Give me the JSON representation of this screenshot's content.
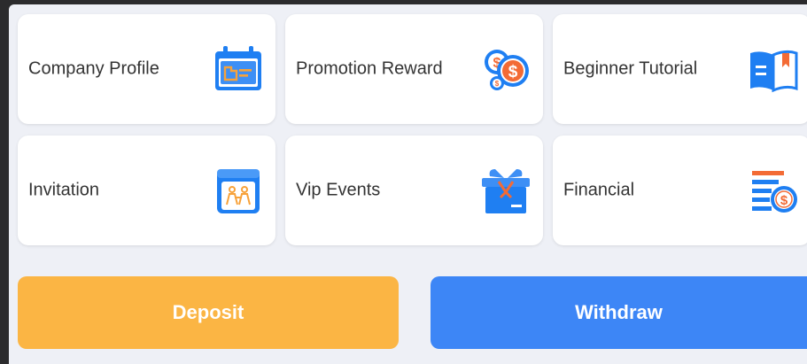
{
  "cards": [
    {
      "label": "Company Profile",
      "icon": "company-profile-icon"
    },
    {
      "label": "Promotion Reward",
      "icon": "coins-icon"
    },
    {
      "label": "Beginner Tutorial",
      "icon": "open-book-icon"
    },
    {
      "label": "Invitation",
      "icon": "invitation-icon"
    },
    {
      "label": "Vip Events",
      "icon": "gift-box-icon"
    },
    {
      "label": "Financial",
      "icon": "financial-icon"
    }
  ],
  "actions": {
    "deposit_label": "Deposit",
    "withdraw_label": "Withdraw"
  },
  "colors": {
    "background": "#eef0f6",
    "card": "#ffffff",
    "deposit": "#fbb544",
    "withdraw": "#3d86f6",
    "icon_blue": "#1f7ff2",
    "icon_orange": "#f36b35"
  }
}
